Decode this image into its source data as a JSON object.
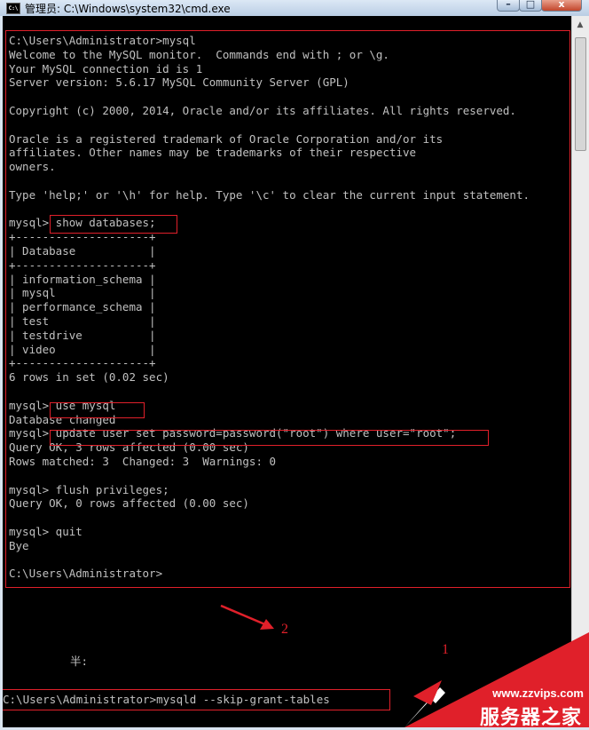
{
  "window": {
    "title": "管理员: C:\\Windows\\system32\\cmd.exe",
    "icon_label": "C:\\",
    "minimize_glyph": "–",
    "maximize_glyph": "□",
    "close_glyph": "x",
    "scroll_up_glyph": "▲"
  },
  "console": {
    "lines": [
      "C:\\Users\\Administrator>mysql",
      "Welcome to the MySQL monitor.  Commands end with ; or \\g.",
      "Your MySQL connection id is 1",
      "Server version: 5.6.17 MySQL Community Server (GPL)",
      "",
      "Copyright (c) 2000, 2014, Oracle and/or its affiliates. All rights reserved.",
      "",
      "Oracle is a registered trademark of Oracle Corporation and/or its",
      "affiliates. Other names may be trademarks of their respective",
      "owners.",
      "",
      "Type 'help;' or '\\h' for help. Type '\\c' to clear the current input statement.",
      "",
      "mysql> show databases;",
      "+--------------------+",
      "| Database           |",
      "+--------------------+",
      "| information_schema |",
      "| mysql              |",
      "| performance_schema |",
      "| test               |",
      "| testdrive          |",
      "| video              |",
      "+--------------------+",
      "6 rows in set (0.02 sec)",
      "",
      "mysql> use mysql",
      "Database changed",
      "mysql> update user set password=password(\"root\") where user=\"root\";",
      "Query OK, 3 rows affected (0.00 sec)",
      "Rows matched: 3  Changed: 3  Warnings: 0",
      "",
      "mysql> flush privileges;",
      "Query OK, 0 rows affected (0.00 sec)",
      "",
      "mysql> quit",
      "Bye",
      "",
      "C:\\Users\\Administrator>"
    ],
    "ime_status": "半:",
    "bottom_command": "C:\\Users\\Administrator>mysqld --skip-grant-tables"
  },
  "annotations": {
    "label_1": "1",
    "label_2": "2",
    "highlight_color": "#e0202a"
  },
  "watermark": {
    "url": "www.zzvips.com",
    "name": "服务器之家",
    "color": "#e0202a"
  }
}
